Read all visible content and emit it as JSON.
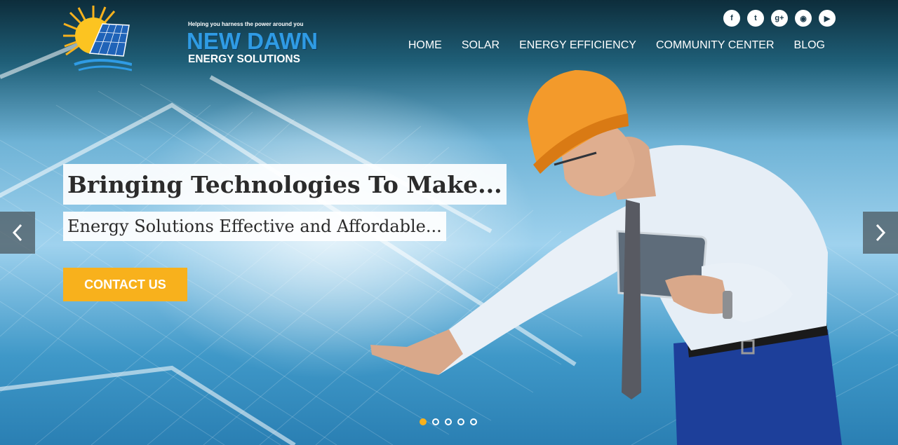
{
  "logo": {
    "tagline": "Helping you harness the power around you",
    "name": "NEW DAWN",
    "subname": "ENERGY SOLUTIONS"
  },
  "social": [
    {
      "icon": "facebook-icon",
      "glyph": "f"
    },
    {
      "icon": "twitter-icon",
      "glyph": "t"
    },
    {
      "icon": "google-plus-icon",
      "glyph": "g+"
    },
    {
      "icon": "rss-icon",
      "glyph": "◉"
    },
    {
      "icon": "youtube-icon",
      "glyph": "▶"
    }
  ],
  "nav": {
    "items": [
      "HOME",
      "SOLAR",
      "ENERGY EFFICIENCY",
      "COMMUNITY CENTER",
      "BLOG"
    ]
  },
  "hero": {
    "headline": "Bringing Technologies To Make...",
    "subheadline": "Energy Solutions Effective and Affordable...",
    "cta_label": "CONTACT US",
    "slide_count": 5,
    "active_slide": 1
  },
  "colors": {
    "accent": "#f8b11c",
    "brand_blue": "#2f9be4"
  }
}
